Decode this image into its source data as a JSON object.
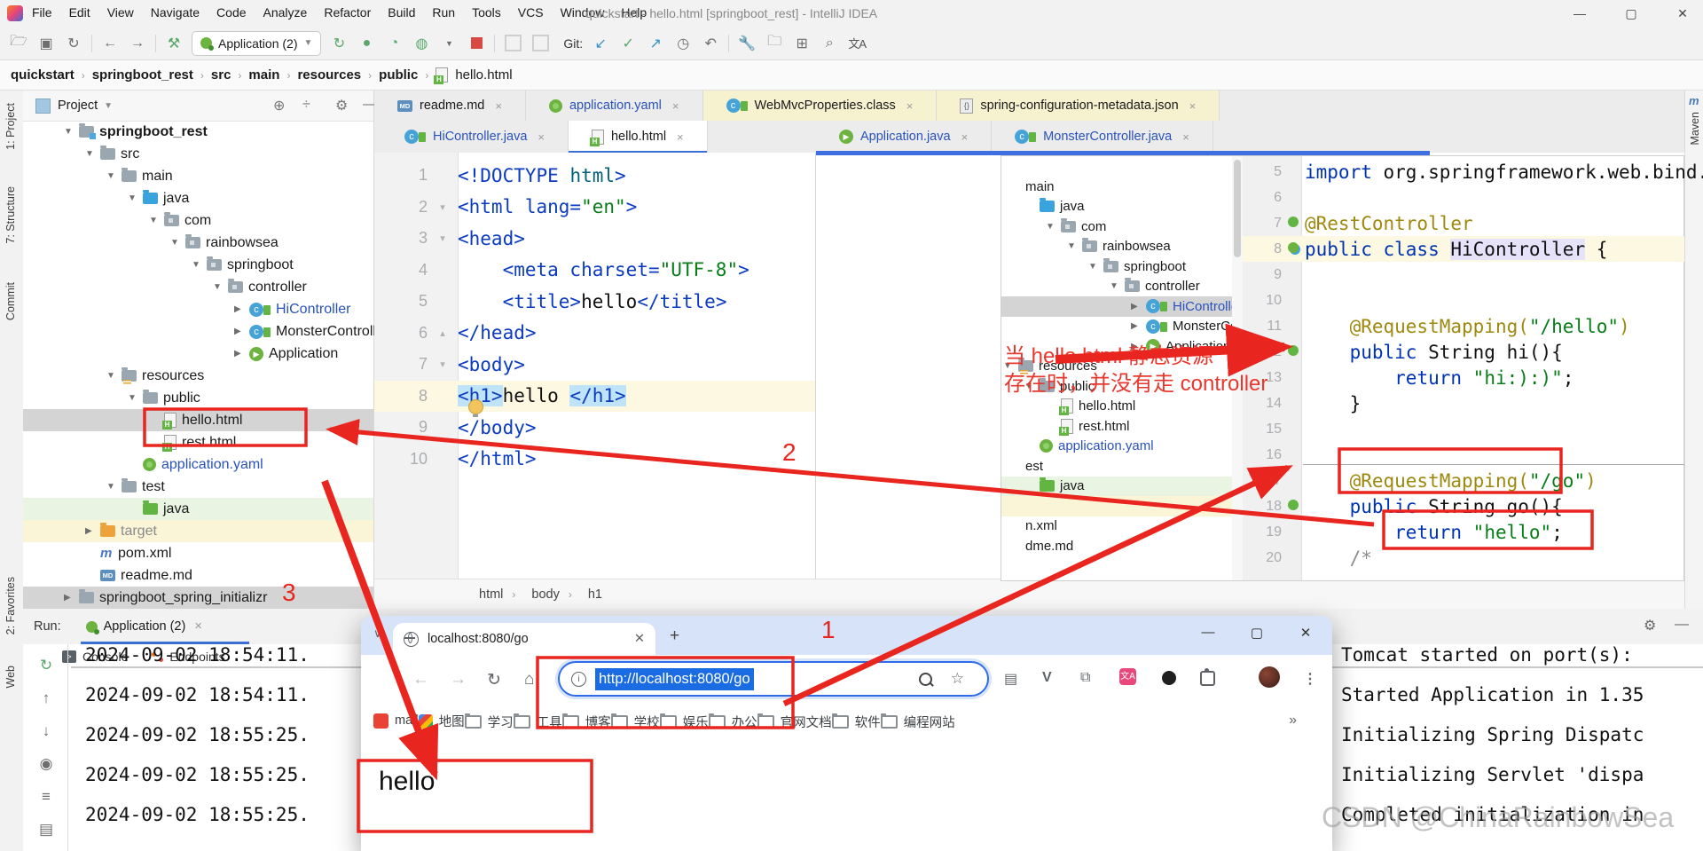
{
  "titlebar": {
    "menu": [
      "File",
      "Edit",
      "View",
      "Navigate",
      "Code",
      "Analyze",
      "Refactor",
      "Build",
      "Run",
      "Tools",
      "VCS",
      "Window",
      "Help"
    ],
    "title": "quickstart - hello.html [springboot_rest] - IntelliJ IDEA"
  },
  "toolbar": {
    "run_config": "Application (2)",
    "git_label": "Git:",
    "translate_icon": "文A"
  },
  "breadcrumbs": {
    "items": [
      "quickstart",
      "springboot_rest",
      "src",
      "main",
      "resources",
      "public"
    ],
    "file": "hello.html"
  },
  "stripes": {
    "project": "1: Project",
    "structure": "7: Structure",
    "commit": "Commit",
    "favorites": "2: Favorites",
    "web": "Web",
    "maven": "Maven",
    "maven_m": "m"
  },
  "project": {
    "header": "Project",
    "tree": [
      {
        "label": "springboot_rest",
        "level": 0,
        "icon": "folder-proj",
        "arrow": "▼",
        "bold": "true",
        "row": "",
        "color": ""
      },
      {
        "label": "src",
        "level": 1,
        "icon": "folder",
        "arrow": "▼",
        "row": "",
        "color": ""
      },
      {
        "label": "main",
        "level": 2,
        "icon": "folder",
        "arrow": "▼",
        "row": "",
        "color": ""
      },
      {
        "label": "java",
        "level": 3,
        "icon": "folder-blue",
        "arrow": "▼",
        "row": "",
        "color": ""
      },
      {
        "label": "com",
        "level": 4,
        "icon": "pkg",
        "arrow": "▼",
        "row": "",
        "color": ""
      },
      {
        "label": "rainbowsea",
        "level": 5,
        "icon": "pkg",
        "arrow": "▼",
        "row": "",
        "color": ""
      },
      {
        "label": "springboot",
        "level": 6,
        "icon": "pkg",
        "arrow": "▼",
        "row": "",
        "color": ""
      },
      {
        "label": "controller",
        "level": 7,
        "icon": "pkg",
        "arrow": "▼",
        "row": "",
        "color": ""
      },
      {
        "label": "HiController",
        "level": 8,
        "icon": "class",
        "arrow": "▶",
        "row": "",
        "color": "blue"
      },
      {
        "label": "MonsterController",
        "level": 8,
        "icon": "class",
        "arrow": "▶",
        "row": "",
        "color": ""
      },
      {
        "label": "Application",
        "level": 8,
        "icon": "spring-run",
        "arrow": "▶",
        "row": "",
        "color": ""
      },
      {
        "label": "resources",
        "level": 2,
        "icon": "folder-res",
        "arrow": "▼",
        "row": "",
        "color": ""
      },
      {
        "label": "public",
        "level": 3,
        "icon": "folder",
        "arrow": "▼",
        "row": "",
        "color": ""
      },
      {
        "label": "hello.html",
        "level": 4,
        "icon": "html",
        "arrow": "",
        "row": "sel",
        "color": ""
      },
      {
        "label": "rest.html",
        "level": 4,
        "icon": "html",
        "arrow": "",
        "row": "",
        "color": ""
      },
      {
        "label": "application.yaml",
        "level": 3,
        "icon": "yaml",
        "arrow": "",
        "row": "",
        "color": "blue"
      },
      {
        "label": "test",
        "level": 2,
        "icon": "folder",
        "arrow": "▼",
        "row": "",
        "color": ""
      },
      {
        "label": "java",
        "level": 3,
        "icon": "folder-green",
        "arrow": "",
        "row": "green",
        "color": ""
      },
      {
        "label": "target",
        "level": 1,
        "icon": "folder-orange",
        "arrow": "▶",
        "row": "yellow",
        "color": "dim"
      },
      {
        "label": "pom.xml",
        "level": 1,
        "icon": "maven",
        "arrow": "",
        "row": "",
        "color": ""
      },
      {
        "label": "readme.md",
        "level": 1,
        "icon": "md",
        "arrow": "",
        "row": "",
        "color": ""
      },
      {
        "label": "springboot_spring_initializr",
        "level": 0,
        "icon": "folder",
        "arrow": "▶",
        "row": "sel",
        "color": ""
      }
    ]
  },
  "tabs": {
    "row1": [
      {
        "label": "readme.md",
        "icon": "md",
        "bg": "",
        "close": "×"
      },
      {
        "label": "application.yaml",
        "icon": "yaml",
        "bg": "",
        "close": "×",
        "color": "blue"
      },
      {
        "label": "WebMvcProperties.class",
        "icon": "class",
        "bg": "yellow",
        "close": "×"
      },
      {
        "label": "spring-configuration-metadata.json",
        "icon": "json",
        "bg": "yellow",
        "close": "×"
      }
    ],
    "row2_left": [
      {
        "label": "HiController.java",
        "icon": "class",
        "active": "false",
        "close": "×",
        "color": "blue"
      },
      {
        "label": "hello.html",
        "icon": "html",
        "active": "true",
        "close": "×"
      }
    ],
    "row2_right": [
      {
        "label": "Application.java",
        "icon": "spring-run",
        "active": "false",
        "close": "×",
        "color": "blue"
      },
      {
        "label": "MonsterController.java",
        "icon": "class",
        "active": "false",
        "close": "×",
        "color": "blue"
      }
    ]
  },
  "editor": {
    "lines": [
      {
        "n": "1",
        "fold": "",
        "row": "",
        "parts": [
          {
            "t": "<!DOCTYPE",
            "c": "tag"
          },
          {
            "t": " html",
            "c": "val2"
          },
          {
            "t": ">",
            "c": "tag"
          }
        ]
      },
      {
        "n": "2",
        "fold": "▾",
        "row": "",
        "parts": [
          {
            "t": "<html ",
            "c": "tag"
          },
          {
            "t": "lang=",
            "c": "tag"
          },
          {
            "t": "\"en\"",
            "c": "str"
          },
          {
            "t": ">",
            "c": "tag"
          }
        ]
      },
      {
        "n": "3",
        "fold": "▾",
        "row": "",
        "parts": [
          {
            "t": "<head>",
            "c": "tag"
          }
        ]
      },
      {
        "n": "4",
        "fold": "",
        "row": "",
        "parts": [
          {
            "t": "    ",
            "c": "pl"
          },
          {
            "t": "<meta charset=",
            "c": "tag"
          },
          {
            "t": "\"UTF-8\"",
            "c": "str"
          },
          {
            "t": ">",
            "c": "tag"
          }
        ]
      },
      {
        "n": "5",
        "fold": "",
        "row": "",
        "parts": [
          {
            "t": "    ",
            "c": "pl"
          },
          {
            "t": "<title>",
            "c": "tag"
          },
          {
            "t": "hello",
            "c": "txt"
          },
          {
            "t": "</title>",
            "c": "tag"
          }
        ]
      },
      {
        "n": "6",
        "fold": "▴",
        "row": "",
        "parts": [
          {
            "t": "</head>",
            "c": "tag"
          }
        ]
      },
      {
        "n": "7",
        "fold": "▾",
        "row": "",
        "parts": [
          {
            "t": "<body>",
            "c": "tag"
          }
        ]
      },
      {
        "n": "8",
        "fold": "",
        "row": "caret",
        "parts": [
          {
            "t": "<h1>",
            "c": "tagsel"
          },
          {
            "t": "hello ",
            "c": "txt"
          },
          {
            "t": "</h1>",
            "c": "tagsel"
          }
        ]
      },
      {
        "n": "9",
        "fold": "",
        "row": "",
        "parts": [
          {
            "t": "</body>",
            "c": "tag"
          }
        ]
      },
      {
        "n": "10",
        "fold": "",
        "row": "",
        "parts": [
          {
            "t": "</html>",
            "c": "tag"
          }
        ]
      }
    ],
    "breadcrumb": [
      "html",
      "body",
      "h1"
    ]
  },
  "overlay": {
    "tree": [
      {
        "label": "main",
        "level": 0,
        "icon": "none",
        "arrow": "",
        "row": "",
        "color": ""
      },
      {
        "label": "java",
        "level": 1,
        "icon": "folder-blue",
        "arrow": "",
        "row": "",
        "color": ""
      },
      {
        "label": "com",
        "level": 2,
        "icon": "pkg",
        "arrow": "▼",
        "row": "",
        "color": ""
      },
      {
        "label": "rainbowsea",
        "level": 3,
        "icon": "pkg",
        "arrow": "▼",
        "row": "",
        "color": ""
      },
      {
        "label": "springboot",
        "level": 4,
        "icon": "pkg",
        "arrow": "▼",
        "row": "",
        "color": ""
      },
      {
        "label": "controller",
        "level": 5,
        "icon": "pkg",
        "arrow": "▼",
        "row": "",
        "color": ""
      },
      {
        "label": "HiController",
        "level": 6,
        "icon": "class",
        "arrow": "▶",
        "row": "sel",
        "color": "blue"
      },
      {
        "label": "MonsterController",
        "level": 6,
        "icon": "class",
        "arrow": "▶",
        "row": "",
        "color": ""
      },
      {
        "label": "Application",
        "level": 6,
        "icon": "spring-run",
        "arrow": "▶",
        "row": "",
        "color": ""
      },
      {
        "label": "resources",
        "level": 0,
        "icon": "folder-res",
        "arrow": "▼",
        "row": "",
        "color": ""
      },
      {
        "label": "public",
        "level": 1,
        "icon": "folder",
        "arrow": "▼",
        "row": "",
        "color": ""
      },
      {
        "label": "hello.html",
        "level": 2,
        "icon": "html",
        "arrow": "",
        "row": "",
        "color": ""
      },
      {
        "label": "rest.html",
        "level": 2,
        "icon": "html",
        "arrow": "",
        "row": "",
        "color": ""
      },
      {
        "label": "application.yaml",
        "level": 1,
        "icon": "yaml",
        "arrow": "",
        "row": "",
        "color": "blue"
      },
      {
        "label": "est",
        "level": 0,
        "icon": "none",
        "arrow": "",
        "row": "",
        "color": ""
      },
      {
        "label": "java",
        "level": 1,
        "icon": "folder-green",
        "arrow": "",
        "row": "green",
        "color": ""
      },
      {
        "label": "",
        "level": 0,
        "icon": "none",
        "arrow": "",
        "row": "yellow",
        "color": ""
      },
      {
        "label": "n.xml",
        "level": 0,
        "icon": "none",
        "arrow": "",
        "row": "",
        "color": ""
      },
      {
        "label": "dme.md",
        "level": 0,
        "icon": "none",
        "arrow": "",
        "row": "",
        "color": ""
      }
    ],
    "code": [
      {
        "n": "5",
        "icon": "",
        "row": "",
        "parts": [
          {
            "t": "import ",
            "c": "kw"
          },
          {
            "t": "org.springframework.web.bind.annota",
            "c": "pl"
          }
        ]
      },
      {
        "n": "6",
        "icon": "",
        "row": "",
        "parts": []
      },
      {
        "n": "7",
        "icon": "check",
        "row": "",
        "parts": [
          {
            "t": "@RestController",
            "c": "ann"
          }
        ]
      },
      {
        "n": "8",
        "icon": "boot",
        "row": "caret",
        "parts": [
          {
            "t": "public class ",
            "c": "kw"
          },
          {
            "t": "HiController",
            "c": "hl"
          },
          {
            "t": " {",
            "c": "pl"
          }
        ]
      },
      {
        "n": "9",
        "icon": "",
        "row": "",
        "parts": []
      },
      {
        "n": "10",
        "icon": "",
        "row": "",
        "parts": []
      },
      {
        "n": "11",
        "icon": "",
        "row": "",
        "parts": [
          {
            "t": "    ",
            "c": "pl"
          },
          {
            "t": "@RequestMapping(",
            "c": "ann"
          },
          {
            "t": "\"/hello\"",
            "c": "str"
          },
          {
            "t": ")",
            "c": "ann"
          }
        ]
      },
      {
        "n": "12",
        "icon": "leaf",
        "row": "",
        "parts": [
          {
            "t": "    ",
            "c": "pl"
          },
          {
            "t": "public ",
            "c": "kw"
          },
          {
            "t": "String hi(){",
            "c": "pl"
          }
        ]
      },
      {
        "n": "13",
        "icon": "",
        "row": "",
        "parts": [
          {
            "t": "        ",
            "c": "pl"
          },
          {
            "t": "return ",
            "c": "kw"
          },
          {
            "t": "\"hi:):)\"",
            "c": "str"
          },
          {
            "t": ";",
            "c": "pl"
          }
        ]
      },
      {
        "n": "14",
        "icon": "",
        "row": "",
        "parts": [
          {
            "t": "    }",
            "c": "pl"
          }
        ]
      },
      {
        "n": "15",
        "icon": "",
        "row": "",
        "parts": []
      },
      {
        "n": "16",
        "icon": "",
        "row": "",
        "parts": []
      },
      {
        "n": "17",
        "icon": "",
        "row": "",
        "parts": [
          {
            "t": "    ",
            "c": "pl"
          },
          {
            "t": "@RequestMapping(",
            "c": "ann"
          },
          {
            "t": "\"/go\"",
            "c": "str"
          },
          {
            "t": ")",
            "c": "ann"
          }
        ]
      },
      {
        "n": "18",
        "icon": "leaf",
        "row": "",
        "parts": [
          {
            "t": "    ",
            "c": "pl"
          },
          {
            "t": "public ",
            "c": "kw"
          },
          {
            "t": "String go(){",
            "c": "pl"
          }
        ]
      },
      {
        "n": "19",
        "icon": "",
        "row": "",
        "parts": [
          {
            "t": "        ",
            "c": "pl"
          },
          {
            "t": "return ",
            "c": "kw"
          },
          {
            "t": "\"hello\"",
            "c": "str"
          },
          {
            "t": ";",
            "c": "pl"
          }
        ]
      },
      {
        "n": "20",
        "icon": "",
        "row": "",
        "parts": [
          {
            "t": "    /*",
            "c": "cmt"
          }
        ]
      }
    ],
    "note_line1": "当 hello.html 静态资源",
    "note_line2": "存在时，并没有走 controller"
  },
  "run": {
    "label": "Run:",
    "config": "Application (2)",
    "tab_console": "Console",
    "tab_endpoints": "Endpoints",
    "console_left": [
      "2024-09-02 18:54:11.",
      "2024-09-02 18:54:11.",
      "2024-09-02 18:55:25.",
      "2024-09-02 18:55:25.",
      "2024-09-02 18:55:25."
    ],
    "console_right": [
      "Tomcat started on port(s):",
      "Started Application in 1.35",
      "Initializing Spring Dispatc",
      "Initializing Servlet 'dispa",
      "Completed initialization in"
    ]
  },
  "browser": {
    "tab": "localhost:8080/go",
    "url": "http://localhost:8080/go",
    "bookmarks": [
      {
        "icon": "c",
        "label": "mail"
      },
      {
        "icon": "map",
        "label": "地图"
      },
      {
        "icon": "folder",
        "label": "学习"
      },
      {
        "icon": "folder",
        "label": "工具"
      },
      {
        "icon": "folder",
        "label": "博客"
      },
      {
        "icon": "folder",
        "label": "学校"
      },
      {
        "icon": "folder",
        "label": "娱乐"
      },
      {
        "icon": "folder",
        "label": "办公"
      },
      {
        "icon": "folder",
        "label": "官网文档"
      },
      {
        "icon": "folder",
        "label": "软件"
      },
      {
        "icon": "folder",
        "label": "编程网站"
      }
    ],
    "bookmarks_more": "»",
    "page_text": "hello"
  },
  "annotations": {
    "label1": "1",
    "label2": "2",
    "label3": "3"
  },
  "watermark": "CSDN @ChinaRainbowSea"
}
